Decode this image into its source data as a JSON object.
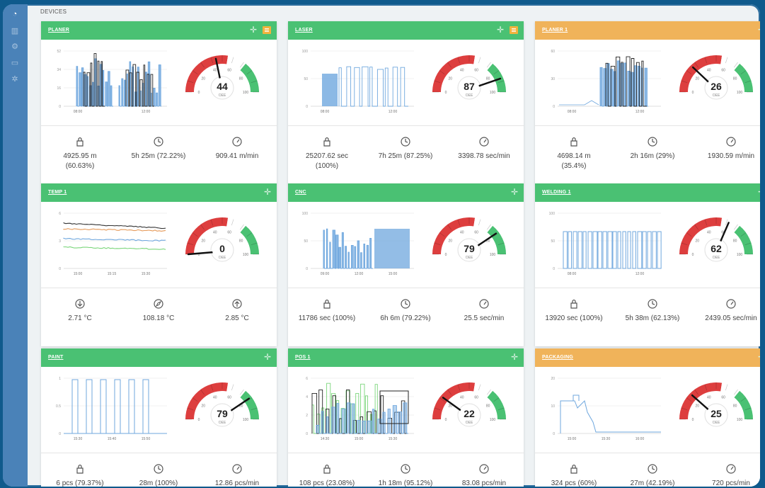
{
  "header": {
    "label": "DEVICES"
  },
  "sidebar": {
    "icons": [
      "logo-icon",
      "chart-icon",
      "settings-icon",
      "monitor-icon",
      "gear-icon"
    ]
  },
  "colors": {
    "green": "#4ac173",
    "orange": "#f0b35a",
    "red": "#dd3e3e",
    "series_blue": "#6fa7de"
  },
  "cards": [
    {
      "title": "PLANER",
      "header_color": "green",
      "menu": true,
      "chart": {
        "yticks": [
          "52",
          "34",
          "16",
          "0"
        ],
        "xticks": [
          "08:00",
          "12:00"
        ],
        "pattern": "planer"
      },
      "gauge": {
        "value": 44,
        "label": "OEE",
        "ticks": [
          "0",
          "20",
          "40",
          "60",
          "80",
          "100"
        ]
      },
      "stats": [
        {
          "icon": "bag-icon",
          "lines": [
            "4925.95 m",
            "(60.63%)"
          ]
        },
        {
          "icon": "clock-icon",
          "lines": [
            "5h 25m (72.22%)"
          ]
        },
        {
          "icon": "speed-icon",
          "lines": [
            "909.41 m/min"
          ]
        }
      ]
    },
    {
      "title": "LASER",
      "header_color": "green",
      "menu": true,
      "chart": {
        "yticks": [
          "100",
          "50",
          "0"
        ],
        "xticks": [
          "08:00",
          "12:00"
        ],
        "pattern": "laser"
      },
      "gauge": {
        "value": 87,
        "label": "OEE",
        "ticks": [
          "0",
          "20",
          "40",
          "60",
          "80",
          "100"
        ]
      },
      "stats": [
        {
          "icon": "bag-icon",
          "lines": [
            "25207.62 sec",
            "(100%)"
          ]
        },
        {
          "icon": "clock-icon",
          "lines": [
            "7h 25m (87.25%)"
          ]
        },
        {
          "icon": "speed-icon",
          "lines": [
            "3398.78 sec/min"
          ]
        }
      ]
    },
    {
      "title": "PLANER 1",
      "header_color": "orange",
      "menu": false,
      "chart": {
        "yticks": [
          "60",
          "30",
          "0"
        ],
        "xticks": [
          "08:00",
          "12:00"
        ],
        "pattern": "planer1"
      },
      "gauge": {
        "value": 26,
        "label": "OEE",
        "ticks": [
          "0",
          "20",
          "40",
          "60",
          "80",
          "100"
        ]
      },
      "stats": [
        {
          "icon": "bag-icon",
          "lines": [
            "4698.14 m",
            "(35.4%)"
          ]
        },
        {
          "icon": "clock-icon",
          "lines": [
            "2h 16m (29%)"
          ]
        },
        {
          "icon": "speed-icon",
          "lines": [
            "1930.59 m/min"
          ]
        }
      ]
    },
    {
      "title": "TEMP 1",
      "header_color": "green",
      "menu": false,
      "chart": {
        "yticks": [
          "6",
          "3",
          "0"
        ],
        "xticks": [
          "15:00",
          "15:15",
          "15:30"
        ],
        "pattern": "temp"
      },
      "gauge": {
        "value": 0,
        "label": "OEE",
        "ticks": [
          "0",
          "20",
          "40",
          "60",
          "80",
          "100"
        ]
      },
      "stats": [
        {
          "icon": "arrow-down-icon",
          "lines": [
            "2.71 °C"
          ]
        },
        {
          "icon": "compass-icon",
          "lines": [
            "108.18 °C"
          ]
        },
        {
          "icon": "arrow-up-icon",
          "lines": [
            "2.85 °C"
          ]
        }
      ]
    },
    {
      "title": "CNC",
      "header_color": "green",
      "menu": false,
      "chart": {
        "yticks": [
          "100",
          "50",
          "0"
        ],
        "xticks": [
          "09:00",
          "12:00",
          "15:00"
        ],
        "pattern": "cnc"
      },
      "gauge": {
        "value": 79,
        "label": "OEE",
        "ticks": [
          "0",
          "20",
          "40",
          "60",
          "80",
          "100"
        ]
      },
      "stats": [
        {
          "icon": "bag-icon",
          "lines": [
            "11786 sec (100%)"
          ]
        },
        {
          "icon": "clock-icon",
          "lines": [
            "6h 6m (79.22%)"
          ]
        },
        {
          "icon": "speed-icon",
          "lines": [
            "25.5 sec/min"
          ]
        }
      ]
    },
    {
      "title": "WELDING 1",
      "header_color": "green",
      "menu": false,
      "chart": {
        "yticks": [
          "100",
          "50",
          "0"
        ],
        "xticks": [
          "08:00",
          "12:00"
        ],
        "pattern": "welding"
      },
      "gauge": {
        "value": 62,
        "label": "OEE",
        "ticks": [
          "0",
          "20",
          "40",
          "60",
          "80",
          "100"
        ]
      },
      "stats": [
        {
          "icon": "bag-icon",
          "lines": [
            "13920 sec (100%)"
          ]
        },
        {
          "icon": "clock-icon",
          "lines": [
            "5h 38m (62.13%)"
          ]
        },
        {
          "icon": "speed-icon",
          "lines": [
            "2439.05 sec/min"
          ]
        }
      ]
    },
    {
      "title": "PAINT",
      "header_color": "green",
      "menu": false,
      "chart": {
        "yticks": [
          "1",
          "0.5",
          "0"
        ],
        "xticks": [
          "15:30",
          "15:40",
          "15:50"
        ],
        "pattern": "paint"
      },
      "gauge": {
        "value": 79,
        "label": "OEE",
        "ticks": [
          "0",
          "20",
          "40",
          "60",
          "80",
          "100"
        ]
      },
      "stats": [
        {
          "icon": "bag-icon",
          "lines": [
            "6 pcs (79.37%)"
          ]
        },
        {
          "icon": "clock-icon",
          "lines": [
            "28m (100%)"
          ]
        },
        {
          "icon": "speed-icon",
          "lines": [
            "12.86 pcs/min"
          ]
        }
      ]
    },
    {
      "title": "POS 1",
      "header_color": "green",
      "menu": false,
      "chart": {
        "yticks": [
          "6",
          "4",
          "2",
          "0"
        ],
        "xticks": [
          "14:30",
          "15:00",
          "15:30"
        ],
        "pattern": "pos"
      },
      "gauge": {
        "value": 22,
        "label": "OEE",
        "ticks": [
          "0",
          "20",
          "40",
          "60",
          "80",
          "100"
        ]
      },
      "stats": [
        {
          "icon": "bag-icon",
          "lines": [
            "108 pcs (23.08%)"
          ]
        },
        {
          "icon": "clock-icon",
          "lines": [
            "1h 18m (95.12%)"
          ]
        },
        {
          "icon": "speed-icon",
          "lines": [
            "83.08 pcs/min"
          ]
        }
      ]
    },
    {
      "title": "PACKAGING",
      "header_color": "orange",
      "menu": false,
      "chart": {
        "yticks": [
          "20",
          "10",
          "0"
        ],
        "xticks": [
          "15:00",
          "15:30",
          "16:00"
        ],
        "pattern": "packaging"
      },
      "gauge": {
        "value": 25,
        "label": "OEE",
        "ticks": [
          "0",
          "20",
          "40",
          "60",
          "80",
          "100"
        ]
      },
      "stats": [
        {
          "icon": "bag-icon",
          "lines": [
            "324 pcs (60%)"
          ]
        },
        {
          "icon": "clock-icon",
          "lines": [
            "27m (42.19%)"
          ]
        },
        {
          "icon": "speed-icon",
          "lines": [
            "720 pcs/min"
          ]
        }
      ]
    }
  ]
}
